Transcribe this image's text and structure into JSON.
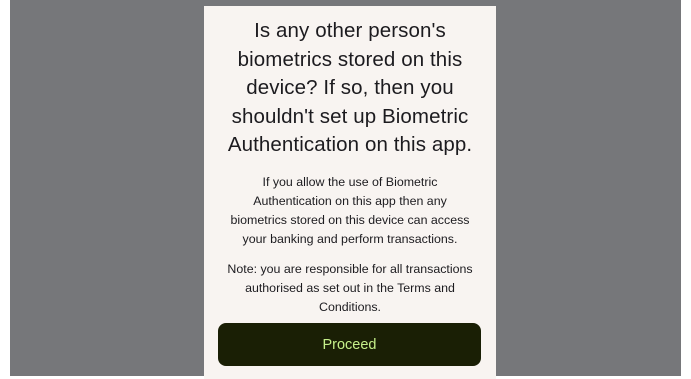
{
  "dialog": {
    "title": "Is any other person's\nbiometrics stored on this\ndevice? If so, then you\nshouldn't set up Biometric\nAuthentication on this app.",
    "body": "If you allow the use of Biometric\nAuthentication on this app then any\nbiometrics stored on this device can access\nyour banking and perform transactions.",
    "note": "Note: you are responsible for all transactions\nauthorised as set out in the Terms and\nConditions.",
    "proceed_label": "Proceed"
  },
  "colors": {
    "backdrop": "#76777a",
    "panel_background": "#f8f4f1",
    "button_background": "#1a1f05",
    "button_text": "#c6f08a",
    "text": "#1c1b1f"
  }
}
